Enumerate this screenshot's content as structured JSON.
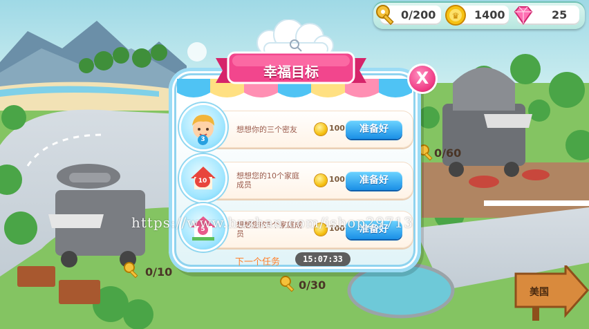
{
  "currency": {
    "keys": "0/200",
    "coins": "1400",
    "gems": "25",
    "key_icon": "key-icon",
    "coin_icon": "coin-icon",
    "gem_icon": "gem-icon"
  },
  "dialog": {
    "title": "幸福目标",
    "close_label": "X",
    "goals": [
      {
        "text": "想想你的三个密友",
        "reward": "100",
        "button": "准备好",
        "badge": "3",
        "icon": "boy-avatar-icon"
      },
      {
        "text": "想想您的10个家庭成员",
        "reward": "100",
        "button": "准备好",
        "badge": "10",
        "icon": "house-icon"
      },
      {
        "text": "想想您的5个家庭成员",
        "reward": "100",
        "button": "准备好",
        "badge": "5",
        "icon": "home-icon"
      }
    ],
    "next_task_label": "下一个任务",
    "countdown": "15:07:33"
  },
  "map": {
    "truck_progress_right": "0/60",
    "truck_progress_left": "0/10",
    "truck_progress_center": "0/30",
    "region_sign": "美国"
  },
  "watermark": "https://www.huzhan.com/ishop29713",
  "colors": {
    "accent_pink": "#f03d86",
    "button_blue": "#1a8fe6",
    "panel_border": "#8fd3ef",
    "next_task_orange": "#ff7f2a"
  }
}
